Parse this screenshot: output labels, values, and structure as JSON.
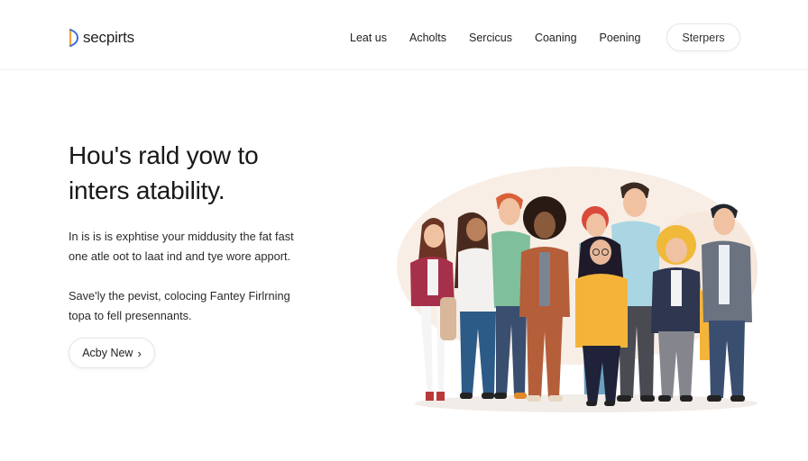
{
  "header": {
    "logo_text": "secpirts",
    "nav": [
      "Leat us",
      "Acholts",
      "Sercicus",
      "Coaning",
      "Poening"
    ],
    "button_label": "Sterpers"
  },
  "hero": {
    "title_lines": [
      "Hou's rald yow to",
      "inters atability."
    ],
    "paragraph1_lines": [
      "In is is is exphtise your middusity the fat fast",
      "one atle oot to laat ind and tye wore apport."
    ],
    "paragraph2_lines": [
      "Save'ly the pevist, colocing Fantey Firlrning",
      "topa to fell presennants."
    ],
    "cta_label": "Acby New",
    "cta_arrow": "›"
  },
  "illustration": {
    "subject": "group-of-diverse-people",
    "colors": {
      "backdrop": "#f7ece3",
      "accent_yellow": "#f4b43a",
      "accent_red": "#a8324a",
      "accent_green": "#7fbf9c",
      "accent_blue": "#9bd0de"
    }
  }
}
